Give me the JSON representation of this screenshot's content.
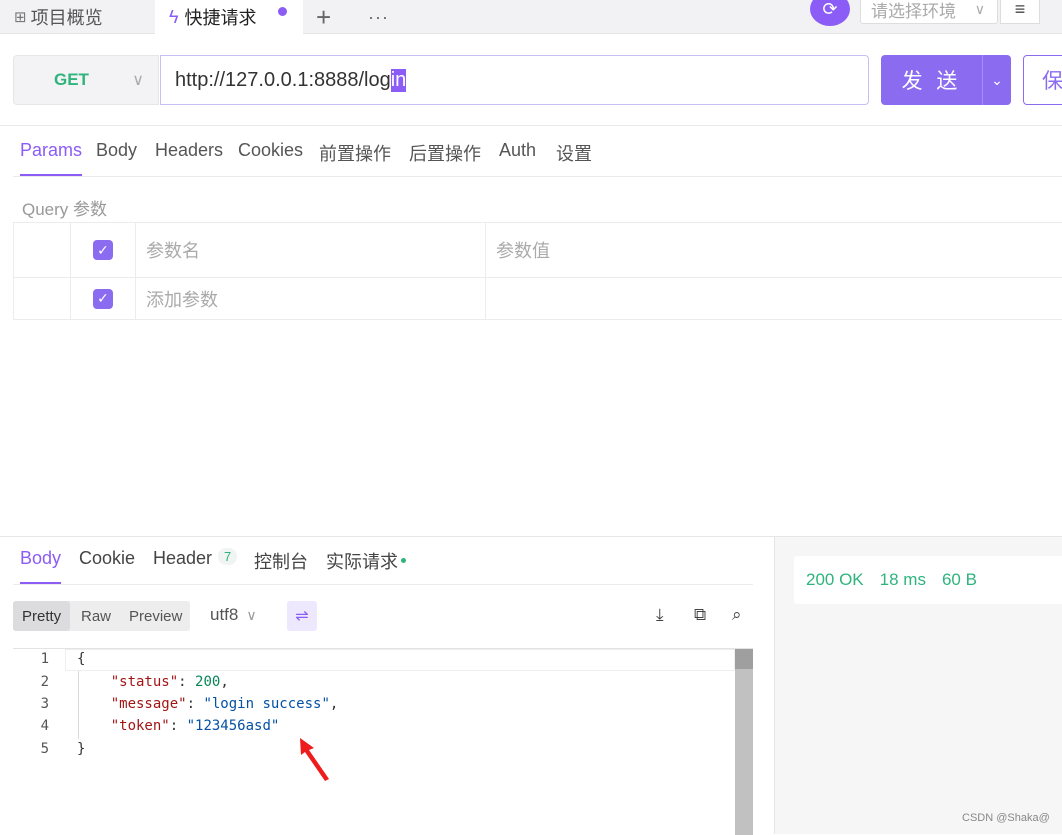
{
  "tabs": {
    "overview": "项目概览",
    "quick": "快捷请求",
    "plus": "+",
    "more": "···"
  },
  "env": {
    "placeholder": "请选择环境"
  },
  "request": {
    "method": "GET",
    "url_prefix": "http://127.0.0.1:8888/log",
    "url_selected": "in",
    "send_label": "发 送",
    "save_label": "保"
  },
  "req_tabs": [
    "Params",
    "Body",
    "Headers",
    "Cookies",
    "前置操作",
    "后置操作",
    "Auth",
    "设置"
  ],
  "params": {
    "section_label": "Query 参数",
    "header_name": "参数名",
    "header_value": "参数值",
    "add_placeholder": "添加参数"
  },
  "response": {
    "tabs": {
      "body": "Body",
      "cookie": "Cookie",
      "header": "Header",
      "header_count": "7",
      "console": "控制台",
      "actual": "实际请求"
    },
    "formats": [
      "Pretty",
      "Raw",
      "Preview"
    ],
    "encoding": "utf8",
    "status": "200 OK",
    "time": "18 ms",
    "size": "60 B",
    "lines": [
      {
        "num": "1",
        "open": "{"
      },
      {
        "num": "2",
        "key": "\"status\"",
        "sep": ": ",
        "value": "200",
        "type": "number",
        "end": ","
      },
      {
        "num": "3",
        "key": "\"message\"",
        "sep": ": ",
        "value": "\"login success\"",
        "type": "string",
        "end": ","
      },
      {
        "num": "4",
        "key": "\"token\"",
        "sep": ": ",
        "value": "\"123456asd\"",
        "type": "string",
        "end": ""
      },
      {
        "num": "5",
        "open": "}"
      }
    ]
  },
  "watermark": "CSDN @Shaka@",
  "colors": {
    "accent": "#8b5cf6",
    "success": "#2fb47d"
  }
}
